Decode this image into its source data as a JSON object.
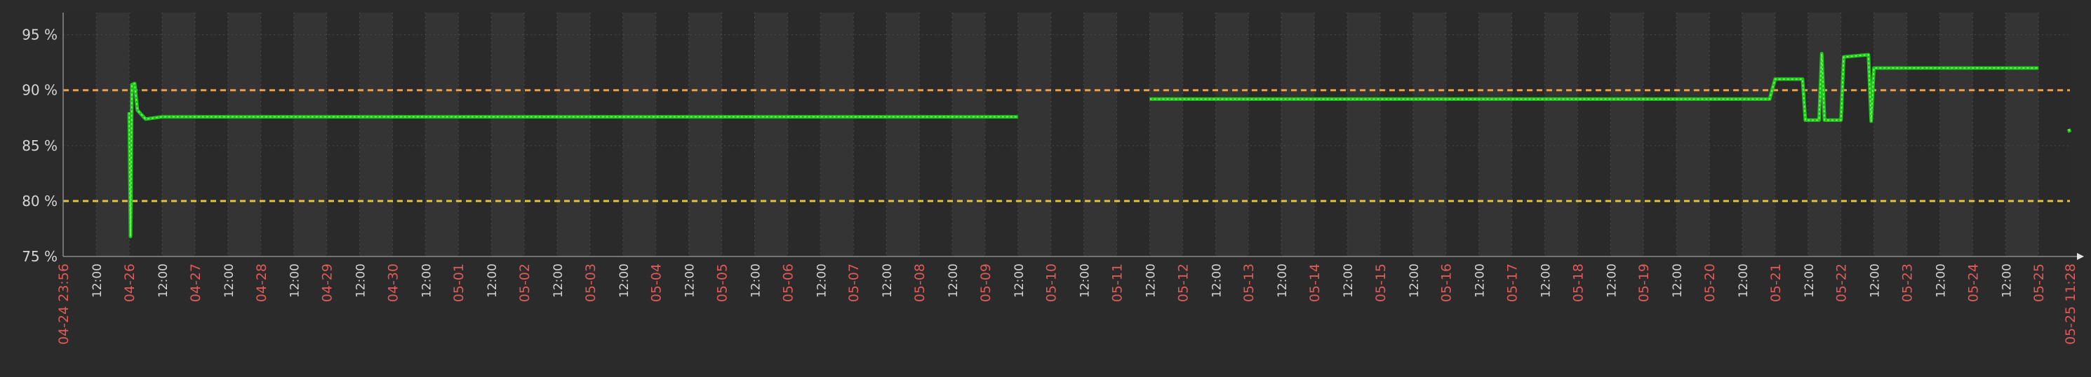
{
  "chart_data": {
    "type": "line",
    "title": "",
    "xlabel": "",
    "ylabel": "",
    "y_unit": "%",
    "ylim": [
      75,
      97
    ],
    "y_ticks": [
      {
        "value": 95,
        "label": "95 %"
      },
      {
        "value": 90,
        "label": "90 %"
      },
      {
        "value": 85,
        "label": "85 %"
      },
      {
        "value": 80,
        "label": "80 %"
      },
      {
        "value": 75,
        "label": "75 %"
      }
    ],
    "x_range": [
      "2024-04-24 23:56",
      "2024-05-25 11:28"
    ],
    "x_start_label": "04-24 23:56",
    "x_end_label": "05-25 11:28",
    "x_ticks": [
      {
        "t": "2024-04-25 12:00",
        "label": "12:00",
        "major": false
      },
      {
        "t": "2024-04-26 00:00",
        "label": "04-26",
        "major": true
      },
      {
        "t": "2024-04-26 12:00",
        "label": "12:00",
        "major": false
      },
      {
        "t": "2024-04-27 00:00",
        "label": "04-27",
        "major": true
      },
      {
        "t": "2024-04-27 12:00",
        "label": "12:00",
        "major": false
      },
      {
        "t": "2024-04-28 00:00",
        "label": "04-28",
        "major": true
      },
      {
        "t": "2024-04-28 12:00",
        "label": "12:00",
        "major": false
      },
      {
        "t": "2024-04-29 00:00",
        "label": "04-29",
        "major": true
      },
      {
        "t": "2024-04-29 12:00",
        "label": "12:00",
        "major": false
      },
      {
        "t": "2024-04-30 00:00",
        "label": "04-30",
        "major": true
      },
      {
        "t": "2024-04-30 12:00",
        "label": "12:00",
        "major": false
      },
      {
        "t": "2024-05-01 00:00",
        "label": "05-01",
        "major": true
      },
      {
        "t": "2024-05-01 12:00",
        "label": "12:00",
        "major": false
      },
      {
        "t": "2024-05-02 00:00",
        "label": "05-02",
        "major": true
      },
      {
        "t": "2024-05-02 12:00",
        "label": "12:00",
        "major": false
      },
      {
        "t": "2024-05-03 00:00",
        "label": "05-03",
        "major": true
      },
      {
        "t": "2024-05-03 12:00",
        "label": "12:00",
        "major": false
      },
      {
        "t": "2024-05-04 00:00",
        "label": "05-04",
        "major": true
      },
      {
        "t": "2024-05-04 12:00",
        "label": "12:00",
        "major": false
      },
      {
        "t": "2024-05-05 00:00",
        "label": "05-05",
        "major": true
      },
      {
        "t": "2024-05-05 12:00",
        "label": "12:00",
        "major": false
      },
      {
        "t": "2024-05-06 00:00",
        "label": "05-06",
        "major": true
      },
      {
        "t": "2024-05-06 12:00",
        "label": "12:00",
        "major": false
      },
      {
        "t": "2024-05-07 00:00",
        "label": "05-07",
        "major": true
      },
      {
        "t": "2024-05-07 12:00",
        "label": "12:00",
        "major": false
      },
      {
        "t": "2024-05-08 00:00",
        "label": "05-08",
        "major": true
      },
      {
        "t": "2024-05-08 12:00",
        "label": "12:00",
        "major": false
      },
      {
        "t": "2024-05-09 00:00",
        "label": "05-09",
        "major": true
      },
      {
        "t": "2024-05-09 12:00",
        "label": "12:00",
        "major": false
      },
      {
        "t": "2024-05-10 00:00",
        "label": "05-10",
        "major": true
      },
      {
        "t": "2024-05-10 12:00",
        "label": "12:00",
        "major": false
      },
      {
        "t": "2024-05-11 00:00",
        "label": "05-11",
        "major": true
      },
      {
        "t": "2024-05-11 12:00",
        "label": "12:00",
        "major": false
      },
      {
        "t": "2024-05-12 00:00",
        "label": "05-12",
        "major": true
      },
      {
        "t": "2024-05-12 12:00",
        "label": "12:00",
        "major": false
      },
      {
        "t": "2024-05-13 00:00",
        "label": "05-13",
        "major": true
      },
      {
        "t": "2024-05-13 12:00",
        "label": "12:00",
        "major": false
      },
      {
        "t": "2024-05-14 00:00",
        "label": "05-14",
        "major": true
      },
      {
        "t": "2024-05-14 12:00",
        "label": "12:00",
        "major": false
      },
      {
        "t": "2024-05-15 00:00",
        "label": "05-15",
        "major": true
      },
      {
        "t": "2024-05-15 12:00",
        "label": "12:00",
        "major": false
      },
      {
        "t": "2024-05-16 00:00",
        "label": "05-16",
        "major": true
      },
      {
        "t": "2024-05-16 12:00",
        "label": "12:00",
        "major": false
      },
      {
        "t": "2024-05-17 00:00",
        "label": "05-17",
        "major": true
      },
      {
        "t": "2024-05-17 12:00",
        "label": "12:00",
        "major": false
      },
      {
        "t": "2024-05-18 00:00",
        "label": "05-18",
        "major": true
      },
      {
        "t": "2024-05-18 12:00",
        "label": "12:00",
        "major": false
      },
      {
        "t": "2024-05-19 00:00",
        "label": "05-19",
        "major": true
      },
      {
        "t": "2024-05-19 12:00",
        "label": "12:00",
        "major": false
      },
      {
        "t": "2024-05-20 00:00",
        "label": "05-20",
        "major": true
      },
      {
        "t": "2024-05-20 12:00",
        "label": "12:00",
        "major": false
      },
      {
        "t": "2024-05-21 00:00",
        "label": "05-21",
        "major": true
      },
      {
        "t": "2024-05-21 12:00",
        "label": "12:00",
        "major": false
      },
      {
        "t": "2024-05-22 00:00",
        "label": "05-22",
        "major": true
      },
      {
        "t": "2024-05-22 12:00",
        "label": "12:00",
        "major": false
      },
      {
        "t": "2024-05-23 00:00",
        "label": "05-23",
        "major": true
      },
      {
        "t": "2024-05-23 12:00",
        "label": "12:00",
        "major": false
      },
      {
        "t": "2024-05-24 00:00",
        "label": "05-24",
        "major": true
      },
      {
        "t": "2024-05-24 12:00",
        "label": "12:00",
        "major": false
      },
      {
        "t": "2024-05-25 00:00",
        "label": "05-25",
        "major": true
      }
    ],
    "thresholds": [
      {
        "value": 90,
        "color": "#e8a04a"
      },
      {
        "value": 80,
        "color": "#e8c040"
      }
    ],
    "grid": true,
    "colors": {
      "background": "#2b2b2b",
      "plot_band_dark": "#2a2a2a",
      "plot_band_light": "#343434",
      "grid": "#4a4a4a",
      "axis": "#8a8a8a",
      "tick_text": "#d6d6d6",
      "major_tick_text": "#e05a5a",
      "series_main": "#1fc41f",
      "series_highlight": "#7dff5c"
    },
    "legend_labels": [
      "",
      "",
      "",
      ""
    ],
    "series": [
      {
        "name": "",
        "segments": [
          [
            [
              "2024-04-26 00:00",
              88.0
            ],
            [
              "2024-04-26 00:30",
              76.8
            ],
            [
              "2024-04-26 01:00",
              90.5
            ],
            [
              "2024-04-26 02:00",
              90.6
            ],
            [
              "2024-04-26 03:00",
              88.2
            ],
            [
              "2024-04-26 06:00",
              87.4
            ],
            [
              "2024-04-26 12:00",
              87.6
            ],
            [
              "2024-04-28 00:00",
              87.6
            ],
            [
              "2024-05-01 00:00",
              87.6
            ],
            [
              "2024-05-04 00:00",
              87.6
            ],
            [
              "2024-05-07 00:00",
              87.6
            ],
            [
              "2024-05-09 12:00",
              87.6
            ]
          ],
          [
            [
              "2024-05-11 12:00",
              89.2
            ],
            [
              "2024-05-14 00:00",
              89.2
            ],
            [
              "2024-05-17 00:00",
              89.2
            ],
            [
              "2024-05-20 00:00",
              89.2
            ],
            [
              "2024-05-20 22:00",
              89.2
            ],
            [
              "2024-05-21 00:00",
              91.0
            ],
            [
              "2024-05-21 10:00",
              91.0
            ],
            [
              "2024-05-21 11:00",
              87.3
            ],
            [
              "2024-05-21 16:00",
              87.3
            ],
            [
              "2024-05-21 17:00",
              93.3
            ],
            [
              "2024-05-21 18:00",
              87.3
            ],
            [
              "2024-05-22 00:00",
              87.3
            ],
            [
              "2024-05-22 01:00",
              93.0
            ],
            [
              "2024-05-22 10:00",
              93.2
            ],
            [
              "2024-05-22 11:00",
              87.2
            ],
            [
              "2024-05-22 12:00",
              92.0
            ],
            [
              "2024-05-23 00:00",
              92.0
            ],
            [
              "2024-05-24 00:00",
              92.0
            ],
            [
              "2024-05-25 00:00",
              92.0
            ]
          ],
          [
            [
              "2024-05-25 11:00",
              86.5
            ],
            [
              "2024-05-25 11:28",
              86.2
            ]
          ]
        ]
      }
    ]
  }
}
